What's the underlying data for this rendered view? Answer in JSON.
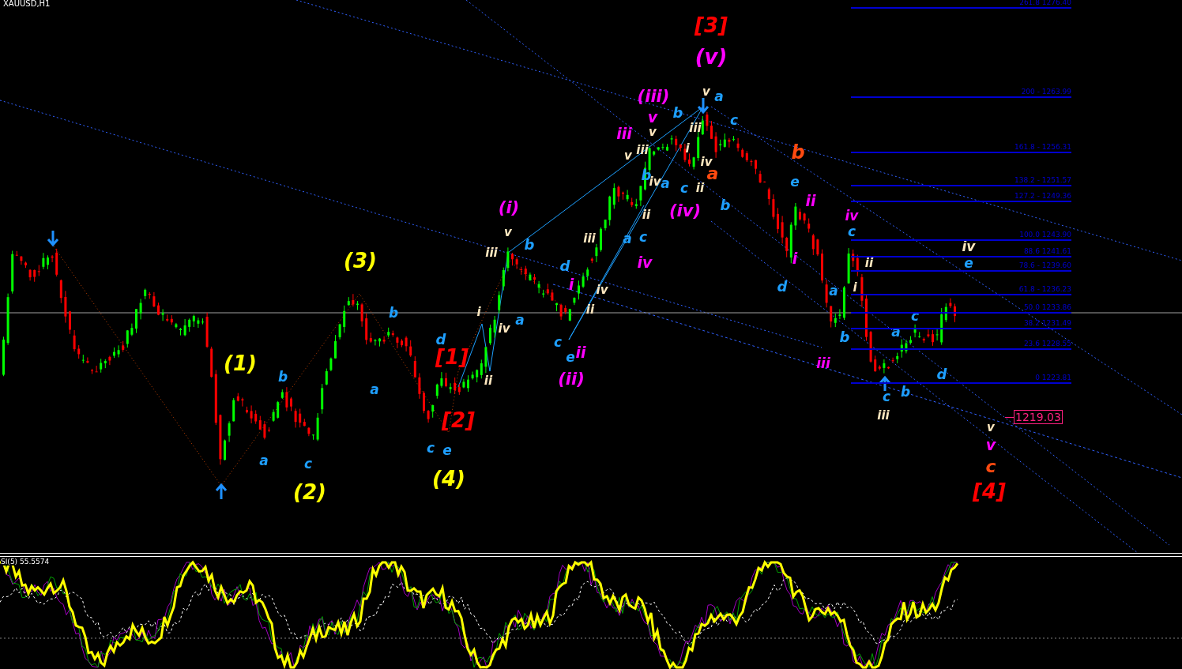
{
  "chart": {
    "symbol": "XAUUSD,H1",
    "wave_labels": [
      {
        "text": "[1]",
        "color": "#ff0000"
      },
      {
        "text": "[2]",
        "color": "#ff0000"
      },
      {
        "text": "[3]",
        "color": "#ff0000"
      },
      {
        "text": "[4]",
        "color": "#ff0000"
      },
      {
        "text": "(1)",
        "color": "#ffff00"
      },
      {
        "text": "(2)",
        "color": "#ffff00"
      },
      {
        "text": "(3)",
        "color": "#ffff00"
      },
      {
        "text": "(4)",
        "color": "#ffff00"
      },
      {
        "text": "(i)",
        "color": "#ff00ff"
      },
      {
        "text": "(ii)",
        "color": "#ff00ff"
      },
      {
        "text": "(iii)",
        "color": "#ff00ff"
      },
      {
        "text": "(iv)",
        "color": "#ff00ff"
      },
      {
        "text": "(v)",
        "color": "#ff00ff"
      },
      {
        "text": "a",
        "color": "#1e9fff"
      },
      {
        "text": "b",
        "color": "#1e9fff"
      },
      {
        "text": "c",
        "color": "#1e9fff"
      },
      {
        "text": "a",
        "color": "#1e9fff"
      },
      {
        "text": "b",
        "color": "#1e9fff"
      },
      {
        "text": "c",
        "color": "#1e9fff"
      },
      {
        "text": "d",
        "color": "#1e9fff"
      },
      {
        "text": "e",
        "color": "#1e9fff"
      },
      {
        "text": "b",
        "color": "#1e9fff"
      },
      {
        "text": "a",
        "color": "#1e9fff"
      },
      {
        "text": "d",
        "color": "#1e9fff"
      },
      {
        "text": "c",
        "color": "#1e9fff"
      },
      {
        "text": "e",
        "color": "#1e9fff"
      },
      {
        "text": "b",
        "color": "#1e9fff"
      },
      {
        "text": "a",
        "color": "#1e9fff"
      },
      {
        "text": "c",
        "color": "#1e9fff"
      },
      {
        "text": "a",
        "color": "#1e9fff"
      },
      {
        "text": "c",
        "color": "#1e9fff"
      },
      {
        "text": "b",
        "color": "#1e9fff"
      },
      {
        "text": "b",
        "color": "#1e9fff"
      },
      {
        "text": "a",
        "color": "#1e9fff"
      },
      {
        "text": "c",
        "color": "#1e9fff"
      },
      {
        "text": "e",
        "color": "#1e9fff"
      },
      {
        "text": "d",
        "color": "#1e9fff"
      },
      {
        "text": "a",
        "color": "#1e9fff"
      },
      {
        "text": "c",
        "color": "#1e9fff"
      },
      {
        "text": "b",
        "color": "#1e9fff"
      },
      {
        "text": "a",
        "color": "#1e9fff"
      },
      {
        "text": "c",
        "color": "#1e9fff"
      },
      {
        "text": "b",
        "color": "#1e9fff"
      },
      {
        "text": "c",
        "color": "#1e9fff"
      },
      {
        "text": "d",
        "color": "#1e9fff"
      },
      {
        "text": "e",
        "color": "#1e9fff"
      },
      {
        "text": "iii",
        "color": "#ffe8c0"
      },
      {
        "text": "v",
        "color": "#ffe8c0"
      },
      {
        "text": "i",
        "color": "#ffe8c0"
      },
      {
        "text": "iv",
        "color": "#ffe8c0"
      },
      {
        "text": "ii",
        "color": "#ffe8c0"
      },
      {
        "text": "iii",
        "color": "#ffe8c0"
      },
      {
        "text": "iv",
        "color": "#ffe8c0"
      },
      {
        "text": "ii",
        "color": "#ffe8c0"
      },
      {
        "text": "v",
        "color": "#ffe8c0"
      },
      {
        "text": "iii",
        "color": "#ffe8c0"
      },
      {
        "text": "v",
        "color": "#ffe8c0"
      },
      {
        "text": "iv",
        "color": "#ffe8c0"
      },
      {
        "text": "ii",
        "color": "#ffe8c0"
      },
      {
        "text": "iii",
        "color": "#ffe8c0"
      },
      {
        "text": "i",
        "color": "#ffe8c0"
      },
      {
        "text": "iv",
        "color": "#ffe8c0"
      },
      {
        "text": "ii",
        "color": "#ffe8c0"
      },
      {
        "text": "v",
        "color": "#ffe8c0"
      },
      {
        "text": "i",
        "color": "#ffe8c0"
      },
      {
        "text": "ii",
        "color": "#ffe8c0"
      },
      {
        "text": "iii",
        "color": "#ffe8c0"
      },
      {
        "text": "iv",
        "color": "#ffe8c0"
      },
      {
        "text": "v",
        "color": "#ffe8c0"
      },
      {
        "text": "iii",
        "color": "#ff00ff"
      },
      {
        "text": "v",
        "color": "#ff00ff"
      },
      {
        "text": "iv",
        "color": "#ff00ff"
      },
      {
        "text": "i",
        "color": "#ff00ff"
      },
      {
        "text": "ii",
        "color": "#ff00ff"
      },
      {
        "text": "ii",
        "color": "#ff00ff"
      },
      {
        "text": "i",
        "color": "#ff00ff"
      },
      {
        "text": "iv",
        "color": "#ff00ff"
      },
      {
        "text": "iii",
        "color": "#ff00ff"
      },
      {
        "text": "v",
        "color": "#ff00ff"
      },
      {
        "text": "a",
        "color": "#ff4a10"
      },
      {
        "text": "b",
        "color": "#ff4a10"
      },
      {
        "text": "c",
        "color": "#ff4a10"
      }
    ],
    "fib_levels": [
      {
        "label": "261.8 1276.40"
      },
      {
        "label": "200 - 1263.99"
      },
      {
        "label": "161.8 -  1256.31"
      },
      {
        "label": "138.2 - 1251.57"
      },
      {
        "label": "127.2 - 1249.36"
      },
      {
        "label": "100.0 1243.90"
      },
      {
        "label": "88.6 1241.61"
      },
      {
        "label": "78.6 - 1239.60"
      },
      {
        "label": "61.8 - 1236.23"
      },
      {
        "label": "50.0 1233.86"
      },
      {
        "label": "38.2 1231.49"
      },
      {
        "label": "23.6 1228.55"
      },
      {
        "label": "0 1223.81"
      }
    ],
    "price_tag": "1219.03"
  },
  "indicator": {
    "label": "SI(5) 55.5574"
  }
}
